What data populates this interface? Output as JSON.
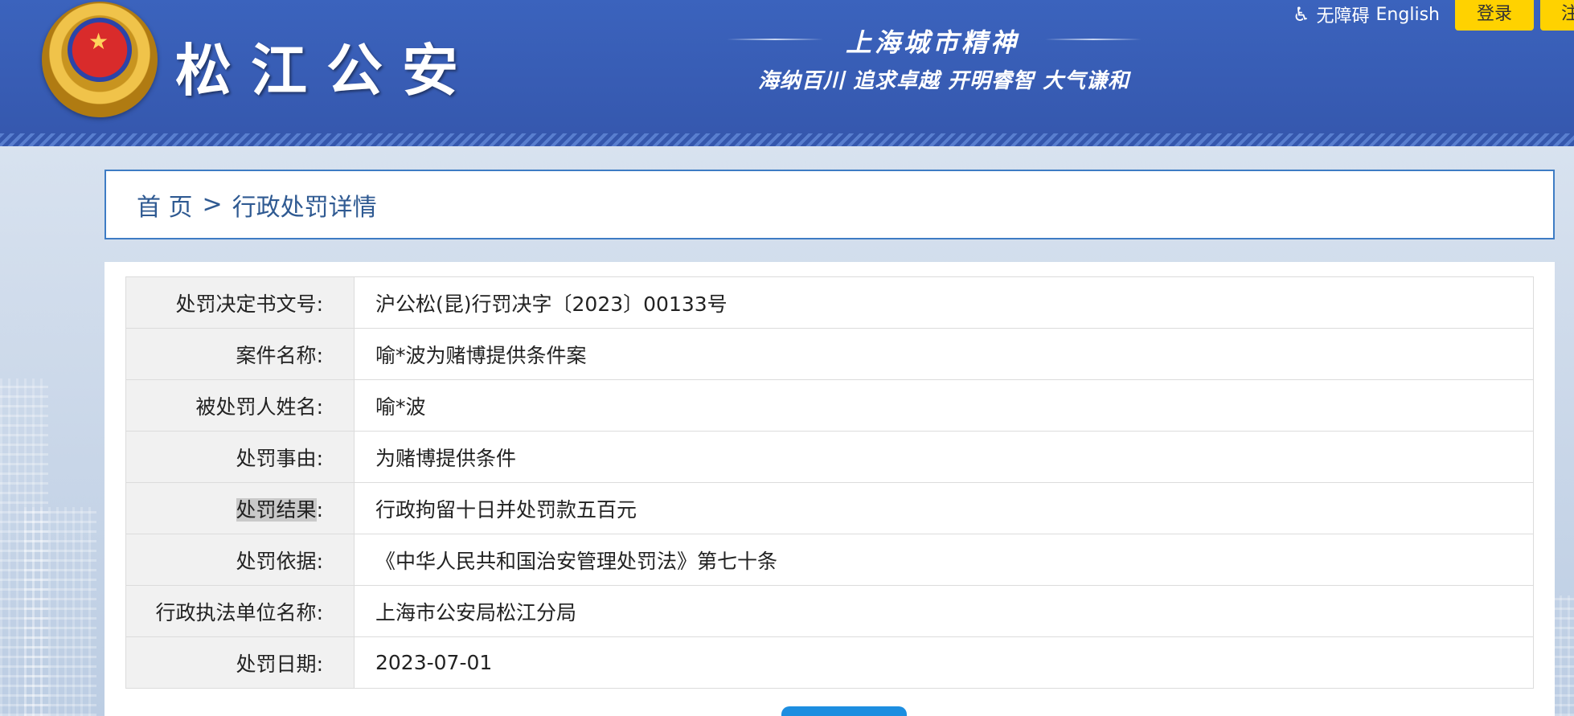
{
  "header": {
    "site_title": "松江公安",
    "spirit_title": "上海城市精神",
    "spirit_motto": "海纳百川 追求卓越 开明睿智 大气谦和",
    "accessibility": "无障碍",
    "english": "English",
    "login": "登录",
    "register": "注"
  },
  "breadcrumb": {
    "home": "首 页",
    "separator": ">",
    "current": "行政处罚详情"
  },
  "details": {
    "rows": [
      {
        "label": "处罚决定书文号",
        "value": "沪公松(昆)行罚决字〔2023〕00133号"
      },
      {
        "label": "案件名称",
        "value": "喻*波为赌博提供条件案"
      },
      {
        "label": "被处罚人姓名",
        "value": "喻*波"
      },
      {
        "label": "处罚事由",
        "value": "为赌博提供条件"
      },
      {
        "label": "处罚结果",
        "value": "行政拘留十日并处罚款五百元"
      },
      {
        "label": "处罚依据",
        "value": "《中华人民共和国治安管理处罚法》第七十条"
      },
      {
        "label": "行政执法单位名称",
        "value": "上海市公安局松江分局"
      },
      {
        "label": "处罚日期",
        "value": "2023-07-01"
      }
    ],
    "colon": ":"
  },
  "colors": {
    "header_blue": "#3b63bd",
    "accent_yellow": "#ffd200",
    "breadcrumb_border": "#3e7cc4",
    "button_blue": "#1d8ee0"
  }
}
